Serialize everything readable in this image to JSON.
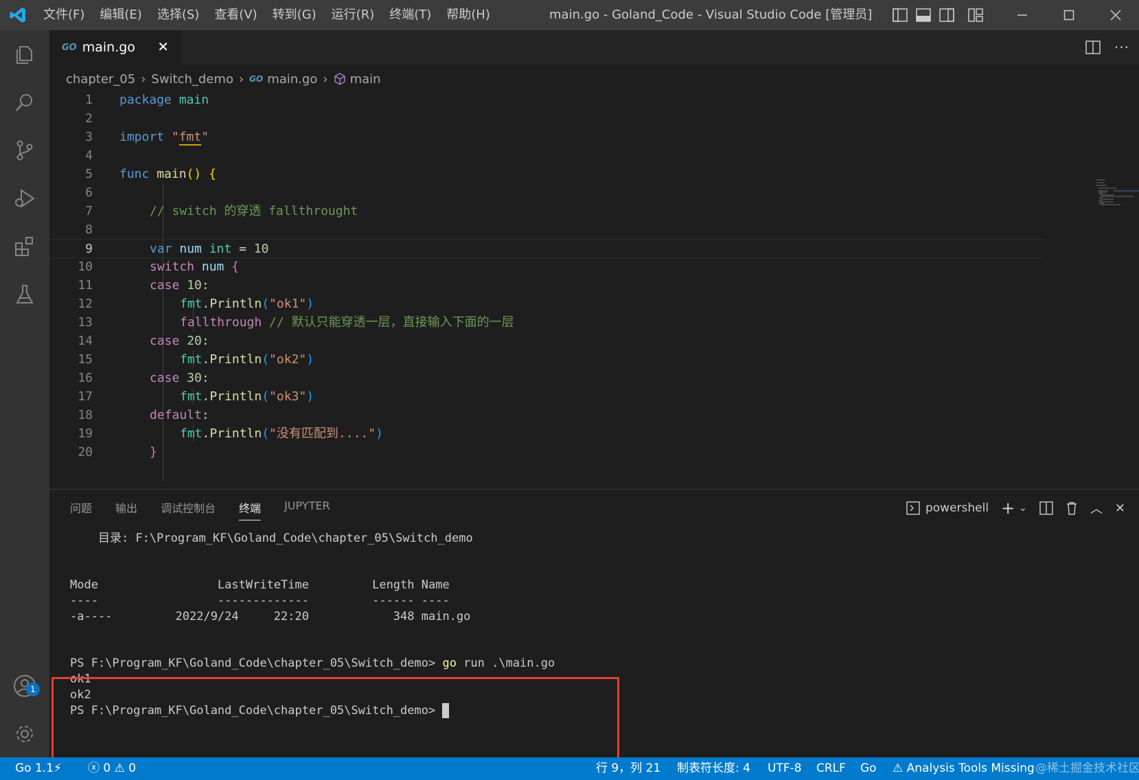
{
  "window": {
    "title": "main.go - Goland_Code - Visual Studio Code [管理员]",
    "menu": [
      "文件(F)",
      "编辑(E)",
      "选择(S)",
      "查看(V)",
      "转到(G)",
      "运行(R)",
      "终端(T)",
      "帮助(H)"
    ]
  },
  "tab": {
    "label": "main.go",
    "icon_text": "GO"
  },
  "breadcrumb": {
    "folder1": "chapter_05",
    "folder2": "Switch_demo",
    "file": "main.go",
    "symbol": "main",
    "go_icon": "GO"
  },
  "editor": {
    "line_numbers": [
      "1",
      "2",
      "3",
      "4",
      "5",
      "6",
      "7",
      "8",
      "9",
      "10",
      "11",
      "12",
      "13",
      "14",
      "15",
      "16",
      "17",
      "18",
      "19",
      "20"
    ],
    "active_line": "9",
    "code": {
      "l1_kw": "package",
      "l1_name": " main",
      "l3_kw": "import",
      "l3_q1": " \"",
      "l3_pkg": "fmt",
      "l3_q2": "\"",
      "l5_kw": "func",
      "l5_fn": " main",
      "l5_paren": "()",
      "l5_brace": " {",
      "l7_cmt": "// switch 的穿透 fallthrought",
      "l9_kw": "var",
      "l9_var": " num",
      "l9_type": " int",
      "l9_eq": " = ",
      "l9_num": "10",
      "l10_kw": "switch",
      "l10_var": " num",
      "l10_brace": " {",
      "l11_kw": "case",
      "l11_num": " 10",
      "l11_colon": ":",
      "l12_pkg": "fmt",
      "l12_dot": ".",
      "l12_fn": "Println",
      "l12_p1": "(",
      "l12_str": "\"ok1\"",
      "l12_p2": ")",
      "l13_kw": "fallthrough",
      "l13_cmt": " // 默认只能穿透一层，直接输入下面的一层",
      "l14_kw": "case",
      "l14_num": " 20",
      "l14_colon": ":",
      "l15_pkg": "fmt",
      "l15_dot": ".",
      "l15_fn": "Println",
      "l15_p1": "(",
      "l15_str": "\"ok2\"",
      "l15_p2": ")",
      "l16_kw": "case",
      "l16_num": " 30",
      "l16_colon": ":",
      "l17_pkg": "fmt",
      "l17_dot": ".",
      "l17_fn": "Println",
      "l17_p1": "(",
      "l17_str": "\"ok3\"",
      "l17_p2": ")",
      "l18_kw": "default",
      "l18_colon": ":",
      "l19_pkg": "fmt",
      "l19_dot": ".",
      "l19_fn": "Println",
      "l19_p1": "(",
      "l19_str": "\"没有匹配到....\"",
      "l19_p2": ")",
      "l20_brace": "}"
    }
  },
  "panel": {
    "tabs": [
      "问题",
      "输出",
      "调试控制台",
      "终端",
      "JUPYTER"
    ],
    "active_tab": "终端",
    "shell": "powershell"
  },
  "terminal": {
    "dir_line": "    目录: F:\\Program_KF\\Goland_Code\\chapter_05\\Switch_demo",
    "header": "Mode                 LastWriteTime         Length Name",
    "divider": "----                 -------------         ------ ----",
    "row": "-a----         2022/9/24     22:20            348 main.go",
    "prompt": "PS F:\\Program_KF\\Goland_Code\\chapter_05\\Switch_demo> ",
    "cmd_go": "go",
    "cmd_rest": " run .\\main.go",
    "out1": "ok1",
    "out2": "ok2"
  },
  "statusbar": {
    "go_version": "Go 1.1",
    "errors": "0",
    "warnings": "0",
    "position": "行 9，列 21",
    "tab_size": "制表符长度: 4",
    "encoding": "UTF-8",
    "eol": "CRLF",
    "language": "Go",
    "analysis": "Analysis Tools Missing",
    "watermark": "@稀土掘金技术社区"
  },
  "activity_badge": "1",
  "colors": {
    "accent": "#007acc",
    "highlight_box": "#e33e33",
    "vscode_logo": "#23a9f2"
  }
}
